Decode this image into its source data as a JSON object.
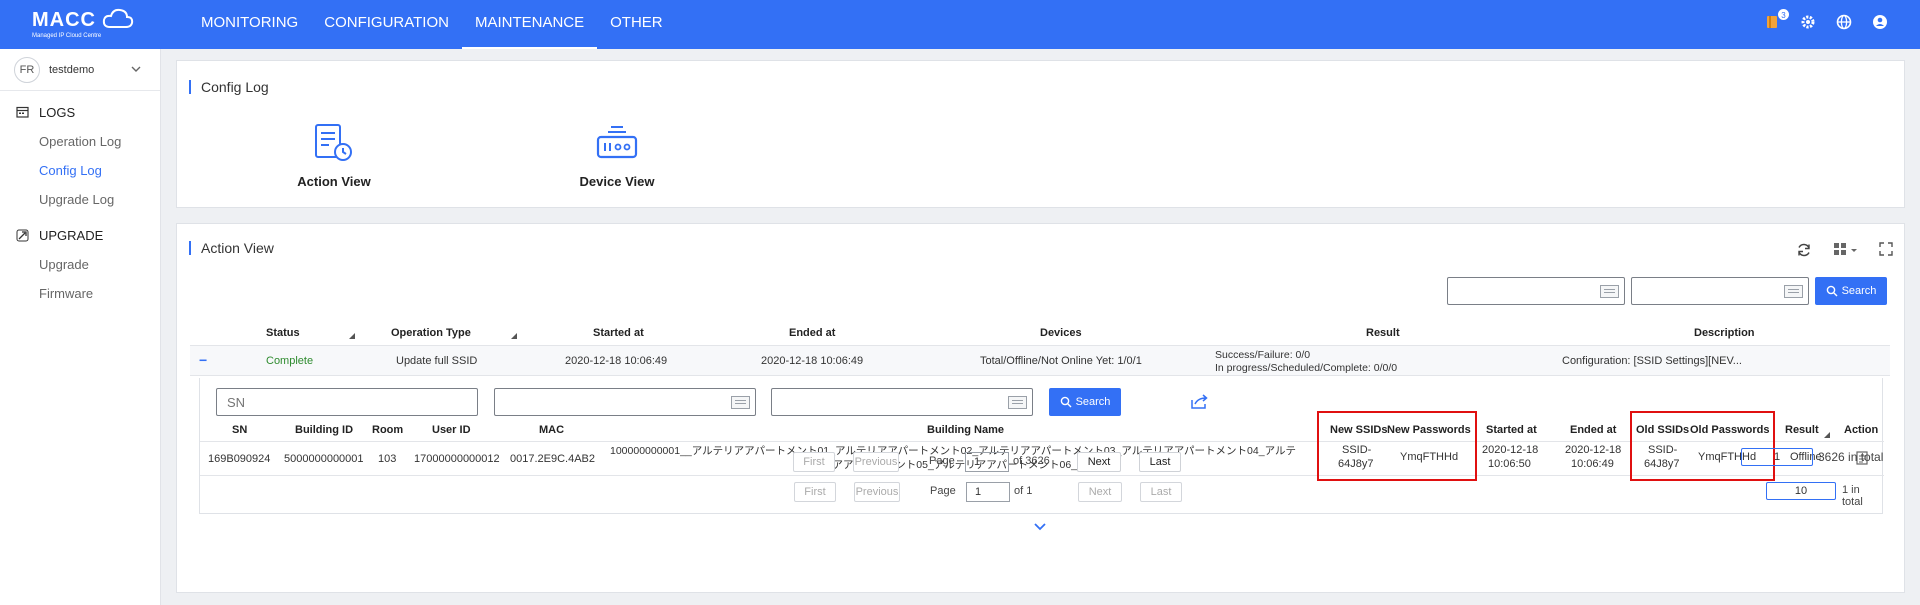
{
  "brand": {
    "name": "MACC",
    "subtitle": "Managed IP Cloud Centre"
  },
  "nav": [
    "MONITORING",
    "CONFIGURATION",
    "MAINTENANCE",
    "OTHER"
  ],
  "notifications": {
    "count": "3"
  },
  "sidebar": {
    "tenant_initials": "FR",
    "tenant": "testdemo",
    "groups": [
      {
        "label": "LOGS",
        "items": [
          "Operation Log",
          "Config Log",
          "Upgrade Log"
        ]
      },
      {
        "label": "UPGRADE",
        "items": [
          "Upgrade",
          "Firmware"
        ]
      }
    ]
  },
  "config_log": {
    "title": "Config Log",
    "views": [
      "Action View",
      "Device View"
    ]
  },
  "action_view": {
    "title": "Action View",
    "search_label": "Search",
    "columns": [
      "Status",
      "Operation Type",
      "Started at",
      "Ended at",
      "Devices",
      "Result",
      "Description"
    ],
    "row": {
      "toggle": "−",
      "status": "Complete",
      "operation_type": "Update full SSID",
      "started": "2020-12-18 10:06:49",
      "ended": "2020-12-18 10:06:49",
      "devices": "Total/Offline/Not Online Yet: 1/0/1",
      "result_line1": "Success/Failure: 0/0",
      "result_line2": "In progress/Scheduled/Complete: 0/0/0",
      "description": "Configuration: [SSID Settings][NEV..."
    },
    "pager": {
      "first": "First",
      "previous": "Previous",
      "page_label": "Page",
      "page": "1",
      "of": "of 3626",
      "next": "Next",
      "last": "Last",
      "size": "1",
      "total": "3626 in total"
    }
  },
  "detail": {
    "sn_placeholder": "SN",
    "search_label": "Search",
    "columns": [
      "SN",
      "Building ID",
      "Room",
      "User ID",
      "MAC",
      "Building Name",
      "New SSIDs",
      "New Passwords",
      "Started at",
      "Ended at",
      "Old SSIDs",
      "Old Passwords",
      "Result",
      "Action"
    ],
    "row": {
      "sn": "169B090924",
      "building_id": "5000000000001",
      "room": "103",
      "user_id": "17000000000012",
      "mac": "0017.2E9C.4AB2",
      "building_name_1": "100000000001__アルテリアアパートメント01_アルテリアアパートメント02_アルテリアアパートメント03_アルテリアアパートメント04_アルテ",
      "building_name_2": "リアアパートメント05_アルテリアアパートメント06_network2",
      "new_ssid_1": "SSID-",
      "new_ssid_2": "64J8y7",
      "new_password": "YmqFTHHd",
      "started_1": "2020-12-18",
      "started_2": "10:06:50",
      "ended_1": "2020-12-18",
      "ended_2": "10:06:49",
      "old_ssid_1": "SSID-",
      "old_ssid_2": "64J8y7",
      "old_password": "YmqFTHHd",
      "result": "Offline"
    },
    "pager": {
      "first": "First",
      "previous": "Previous",
      "page_label": "Page",
      "page": "1",
      "of": "of 1",
      "next": "Next",
      "last": "Last",
      "size": "10",
      "total": "1 in total"
    }
  },
  "colors": {
    "accent": "#3370f5",
    "status_ok": "#2e8b2e",
    "highlight": "#e01010"
  }
}
